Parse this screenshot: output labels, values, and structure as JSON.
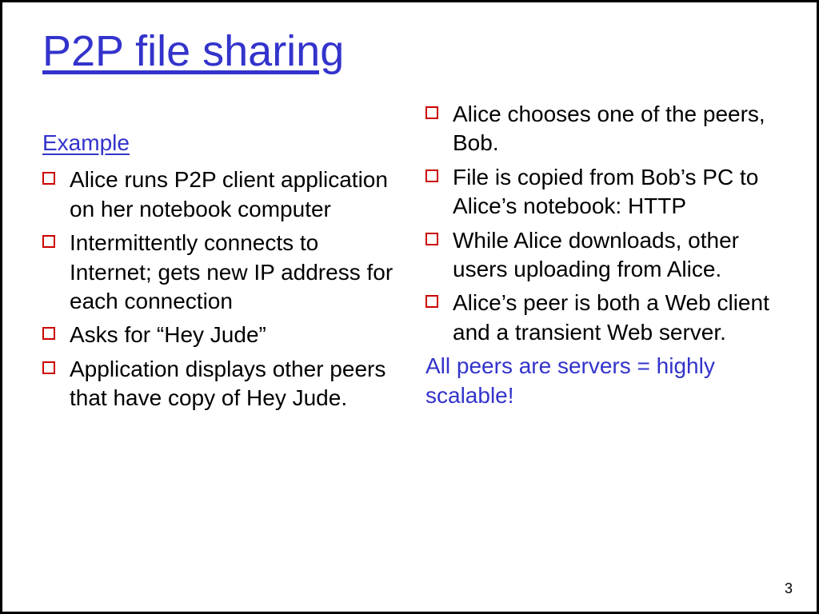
{
  "title": "P2P file sharing",
  "left": {
    "heading": "Example",
    "items": [
      "Alice runs P2P client application on her notebook computer",
      "Intermittently connects to Internet; gets new IP address for each connection",
      "Asks for “Hey Jude”",
      "Application displays other peers that have copy of Hey Jude."
    ]
  },
  "right": {
    "items": [
      "Alice chooses one of the peers, Bob.",
      "File is copied from Bob’s PC to Alice’s notebook: HTTP",
      "While Alice downloads, other users uploading from Alice.",
      "Alice’s peer is both a Web client and a transient Web server."
    ],
    "conclusion": "All peers are servers = highly scalable!"
  },
  "page": "3"
}
